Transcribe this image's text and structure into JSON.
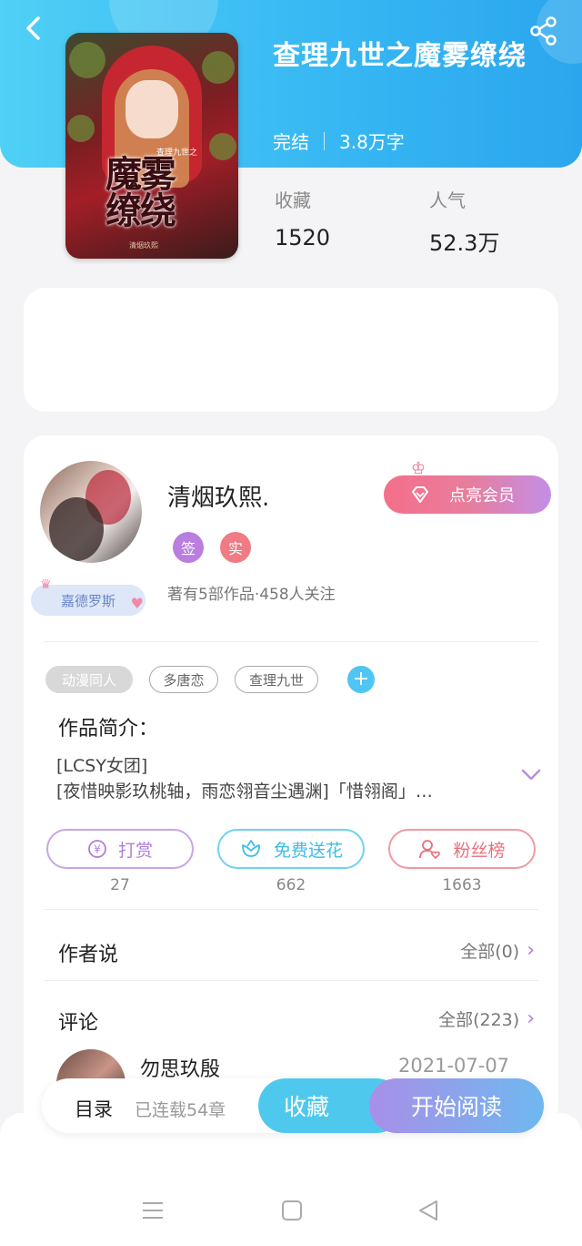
{
  "header": {
    "book_title": "查理九世之魔雾缭绕",
    "status": "完结",
    "word_count": "3.8万字",
    "stats": [
      {
        "label": "收藏",
        "value": "1520"
      },
      {
        "label": "人气",
        "value": "52.3万"
      }
    ]
  },
  "cover": {
    "title": "魔雾缭绕",
    "subtitle": "查理九世之",
    "author_small": "清烟玖熙"
  },
  "author": {
    "name": "清烟玖熙.",
    "badges": [
      "签",
      "实"
    ],
    "stats": "著有5部作品·458人关注",
    "fan_badge": "嘉德罗斯",
    "vip_button": "点亮会员"
  },
  "tags": [
    "动漫同人",
    "多唐恋",
    "查理九世"
  ],
  "intro": {
    "title": "作品简介：",
    "lines": [
      "[LCSY女团]",
      "[夜惜映影玖桃轴，雨恋翎音尘遇渊]「惜翎阁」…"
    ]
  },
  "actions": [
    {
      "label": "打赏",
      "count": "27",
      "icon": "yen-icon"
    },
    {
      "label": "免费送花",
      "count": "662",
      "icon": "flower-icon"
    },
    {
      "label": "粉丝榜",
      "count": "1663",
      "icon": "person-heart-icon"
    }
  ],
  "author_says": {
    "title": "作者说",
    "more": "全部(0)"
  },
  "comments": {
    "title": "评论",
    "more": "全部(223)",
    "first": {
      "user": "勿思玖殷",
      "date": "2021-07-07"
    }
  },
  "bottom_bar": {
    "catalog": "目录",
    "chapters": "已连载54章",
    "collect": "收藏",
    "read": "开始阅读"
  },
  "colors": {
    "header_accent": "#36b6f3",
    "purple_accent": "#b07ddf",
    "pink_accent": "#ea6f7a",
    "cyan_accent": "#3dbde9"
  }
}
